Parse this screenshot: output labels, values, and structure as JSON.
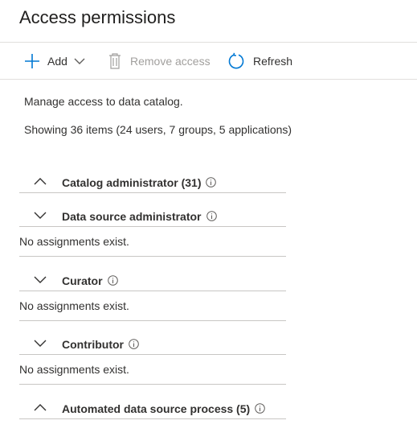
{
  "header": {
    "title": "Access permissions"
  },
  "toolbar": {
    "add_label": "Add",
    "remove_label": "Remove access",
    "refresh_label": "Refresh"
  },
  "summary": {
    "description": "Manage access to data catalog.",
    "count": "Showing 36 items (24 users, 7 groups, 5 applications)"
  },
  "sections": [
    {
      "name": "Catalog administrator (31)",
      "expanded": true,
      "icon": "chevron-up-icon"
    },
    {
      "name": "Data source administrator",
      "expanded": false,
      "icon": "chevron-down-icon",
      "empty_text": "No assignments exist."
    },
    {
      "name": "Curator",
      "expanded": false,
      "icon": "chevron-down-icon",
      "empty_text": "No assignments exist."
    },
    {
      "name": "Contributor",
      "expanded": false,
      "icon": "chevron-down-icon",
      "empty_text": "No assignments exist."
    },
    {
      "name": "Automated data source process (5)",
      "expanded": true,
      "icon": "chevron-up-icon"
    }
  ],
  "colors": {
    "accent": "#0078d4",
    "text": "#323130",
    "disabled": "#a19f9d",
    "divider": "#c8c6c4"
  }
}
